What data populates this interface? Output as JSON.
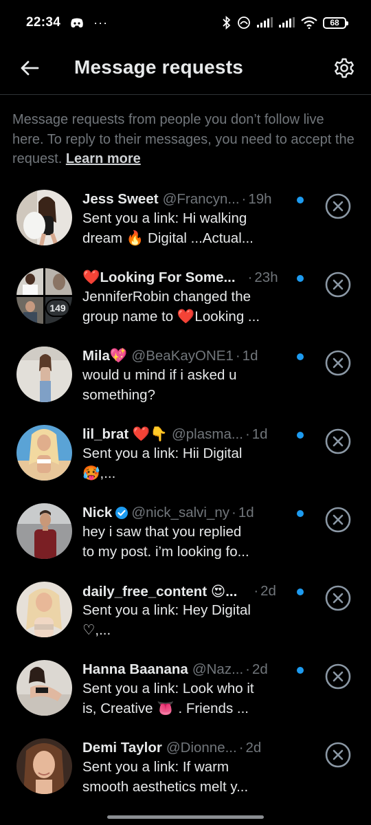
{
  "status_bar": {
    "time": "22:34",
    "overflow": "···",
    "battery": "68"
  },
  "header": {
    "title": "Message requests"
  },
  "intro": {
    "text": "Message requests from people you don’t follow live here. To reply to their messages, you need to accept the request.",
    "link": "Learn more"
  },
  "colors": {
    "background": "#000000",
    "primary_text": "#e7e9ea",
    "secondary_text": "#71767b",
    "unread_dot": "#1d9bf0",
    "verified": "#1d9bf0",
    "heart": "#e0245e"
  },
  "requests": [
    {
      "name": "Jess Sweet",
      "handle": "@Francyn...",
      "sep": "·",
      "time": "19h",
      "message": "Sent you a link: Hi walking\ndream 🔥 Digital ...Actual...",
      "unread": true
    },
    {
      "name": "❤️Looking For Some...",
      "handle": "",
      "sep": "·",
      "time": "23h",
      "message": "JenniferRobin changed the\ngroup name to ❤️Looking ...",
      "unread": true,
      "member_count": "149"
    },
    {
      "name": "Mila💖",
      "handle": "@BeaKayONE1",
      "sep": "·",
      "time": "1d",
      "message": "would u mind if i asked u\nsomething?",
      "unread": true
    },
    {
      "name": "lil_brat ❤️👇",
      "handle": "@plasma...",
      "sep": "·",
      "time": "1d",
      "message": "Sent you a link: Hii Digital\n🥵,...",
      "unread": true
    },
    {
      "name": "Nick",
      "handle": "@nick_salvi_ny",
      "sep": "·",
      "time": "1d",
      "message": "hey i saw that you replied\nto my post. i’m looking fo...",
      "unread": true,
      "verified": true
    },
    {
      "name": "daily_free_content 😍...",
      "handle": "",
      "sep": "·",
      "time": "2d",
      "message": "Sent you a link: Hey Digital\n♡,...",
      "unread": true
    },
    {
      "name": "Hanna Baanana",
      "handle": "@Naz...",
      "sep": "·",
      "time": "2d",
      "message": "Sent you a link: Look who it\nis, Creative 👅 . Friends ...",
      "unread": true
    },
    {
      "name": "Demi Taylor",
      "handle": "@Dionne...",
      "sep": "·",
      "time": "2d",
      "message": "Sent you a link: If warm\nsmooth aesthetics melt y...",
      "unread": true
    }
  ]
}
